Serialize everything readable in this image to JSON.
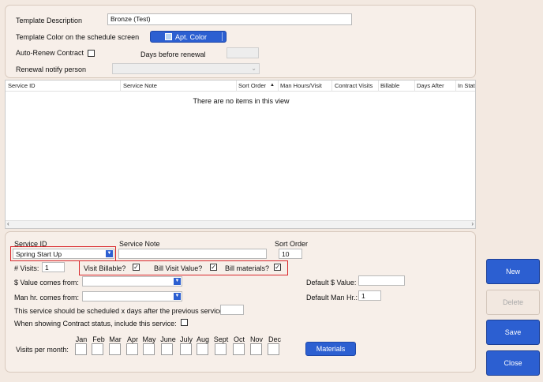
{
  "template": {
    "description_label": "Template Description",
    "description_value": "Bronze (Test)",
    "color_label": "Template Color on the schedule screen",
    "color_button": "Apt. Color",
    "color_swatch": "#b7d3f2",
    "autorenew_label": "Auto-Renew Contract",
    "days_before_label": "Days before renewal",
    "notify_label": "Renewal notify person"
  },
  "grid": {
    "columns": [
      "Service ID",
      "Service Note",
      "Sort Order",
      "Man Hours/Visit",
      "Contract Visits",
      "Billable",
      "Days After",
      "In State"
    ],
    "sort_indicator": "▲",
    "empty_text": "There are no items in this view"
  },
  "detail": {
    "service_id_label": "Service ID",
    "service_id_value": "Spring Start Up",
    "service_note_label": "Service Note",
    "sort_order_label": "Sort Order",
    "sort_order_value": "10",
    "visits_label": "# Visits:",
    "visits_value": "1",
    "visit_billable_label": "Visit Billable?",
    "bill_visit_value_label": "Bill Visit Value?",
    "bill_materials_label": "Bill materials?",
    "value_from_label": "$ Value comes from:",
    "default_value_label": "Default $ Value:",
    "manhr_from_label": "Man hr. comes from:",
    "default_manhr_label": "Default Man Hr.:",
    "default_manhr_value": "1",
    "schedule_days_label": "This service should be scheduled x days after the previous service:",
    "contract_status_label": "When showing Contract status, include this service:",
    "visits_per_month_label": "Visits per month:",
    "months": [
      "Jan",
      "Feb",
      "Mar",
      "Apr",
      "May",
      "June",
      "July",
      "Aug",
      "Sept",
      "Oct",
      "Nov",
      "Dec"
    ],
    "materials_button": "Materials"
  },
  "buttons": {
    "new": "New",
    "delete": "Delete",
    "save": "Save",
    "close": "Close"
  },
  "colors": {
    "accent": "#2c5fd1",
    "highlight_border": "#d9262a",
    "panel_bg": "#f7efe9"
  }
}
